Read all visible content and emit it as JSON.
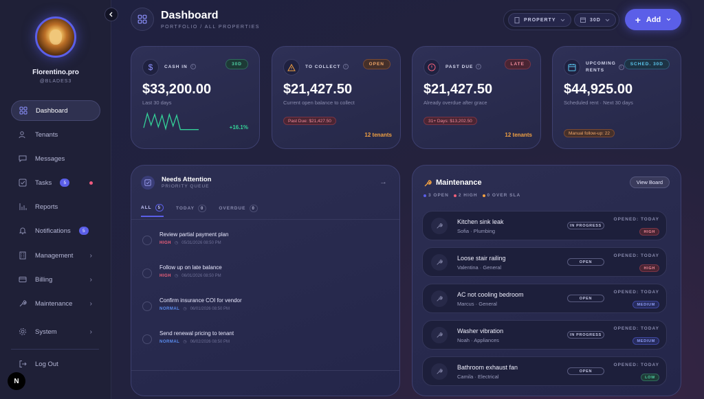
{
  "user": {
    "name": "Florentino.pro",
    "handle": "@BLADES3"
  },
  "sidebar": {
    "items": [
      {
        "label": "Dashboard",
        "icon": "grid-icon"
      },
      {
        "label": "Tenants",
        "icon": "users-icon"
      },
      {
        "label": "Messages",
        "icon": "message-icon"
      },
      {
        "label": "Tasks",
        "icon": "checkbox-icon",
        "badge": "5"
      },
      {
        "label": "Reports",
        "icon": "bar-chart-icon"
      },
      {
        "label": "Notifications",
        "icon": "bell-icon",
        "badge": "5"
      },
      {
        "label": "Management",
        "icon": "building-icon"
      },
      {
        "label": "Billing",
        "icon": "card-icon"
      },
      {
        "label": "Maintenance",
        "icon": "wrench-icon"
      },
      {
        "label": "System",
        "icon": "gear-icon"
      },
      {
        "label": "Log Out",
        "icon": "logout-icon"
      }
    ],
    "footer_badge": "N"
  },
  "header": {
    "title": "Dashboard",
    "breadcrumb": "PORTFOLIO / ALL PROPERTIES",
    "property_select": "PROPERTY",
    "range_select": "30D",
    "add_label": "Add"
  },
  "stats": {
    "cash_in": {
      "label": "CASH IN",
      "tag": "30D",
      "value": "$33,200.00",
      "sub": "Last 30 days",
      "delta": "+16.1%",
      "spark": [
        0.15,
        0.95,
        0.3,
        0.9,
        0.2,
        0.85,
        0.1,
        0.9,
        0.25,
        0.85,
        0.05,
        0.05,
        0.05,
        0.05,
        0.05,
        0.05
      ]
    },
    "to_collect": {
      "label": "TO COLLECT",
      "tag": "OPEN",
      "value": "$21,427.50",
      "sub": "Current open balance to collect",
      "chip": "Past Due: $21,427.50",
      "tenants": "12 tenants"
    },
    "past_due": {
      "label": "PAST DUE",
      "tag": "LATE",
      "value": "$21,427.50",
      "sub": "Already overdue after grace",
      "chip": "31+ Days: $13,202.50",
      "tenants": "12 tenants"
    },
    "upcoming": {
      "label_line1": "UPCOMING",
      "label_line2": "RENTS",
      "tag": "SCHED. 30D",
      "value": "$44,925.00",
      "sub": "Scheduled rent · Next 30 days",
      "chip": "Manual follow-up: 22"
    }
  },
  "attention": {
    "title": "Needs Attention",
    "subtitle": "PRIORITY QUEUE",
    "tabs": [
      {
        "label": "ALL",
        "count": "5"
      },
      {
        "label": "TODAY",
        "count": "0"
      },
      {
        "label": "OVERDUE",
        "count": "0"
      }
    ],
    "tasks": [
      {
        "title": "Review partial payment plan",
        "priority": "HIGH",
        "date": "05/31/2026 08:50 PM"
      },
      {
        "title": "Follow up on late balance",
        "priority": "HIGH",
        "date": "06/01/2026 08:50 PM"
      },
      {
        "title": "Confirm insurance COI for vendor",
        "priority": "NORMAL",
        "date": "06/01/2026 08:50 PM"
      },
      {
        "title": "Send renewal pricing to tenant",
        "priority": "NORMAL",
        "date": "06/02/2026 08:50 PM"
      }
    ]
  },
  "maintenance": {
    "title": "Maintenance",
    "view_board": "View Board",
    "stats": [
      "3 OPEN",
      "2 HIGH",
      "0 OVER SLA"
    ],
    "opened_label": "OPENED: TODAY",
    "items": [
      {
        "title": "Kitchen sink leak",
        "person": "Sofia",
        "category": "Plumbing",
        "status": "IN PROGRESS",
        "priority": "HIGH"
      },
      {
        "title": "Loose stair railing",
        "person": "Valentina",
        "category": "General",
        "status": "OPEN",
        "priority": "HIGH"
      },
      {
        "title": "AC not cooling bedroom",
        "person": "Marcus",
        "category": "General",
        "status": "OPEN",
        "priority": "MEDIUM"
      },
      {
        "title": "Washer vibration",
        "person": "Noah",
        "category": "Appliances",
        "status": "IN PROGRESS",
        "priority": "MEDIUM"
      },
      {
        "title": "Bathroom exhaust fan",
        "person": "Camila",
        "category": "Electrical",
        "status": "OPEN",
        "priority": "LOW"
      }
    ]
  },
  "colors": {
    "accent": "#5b5fe8",
    "positive": "#34d399",
    "warning": "#f2a142",
    "danger": "#f0607a"
  }
}
